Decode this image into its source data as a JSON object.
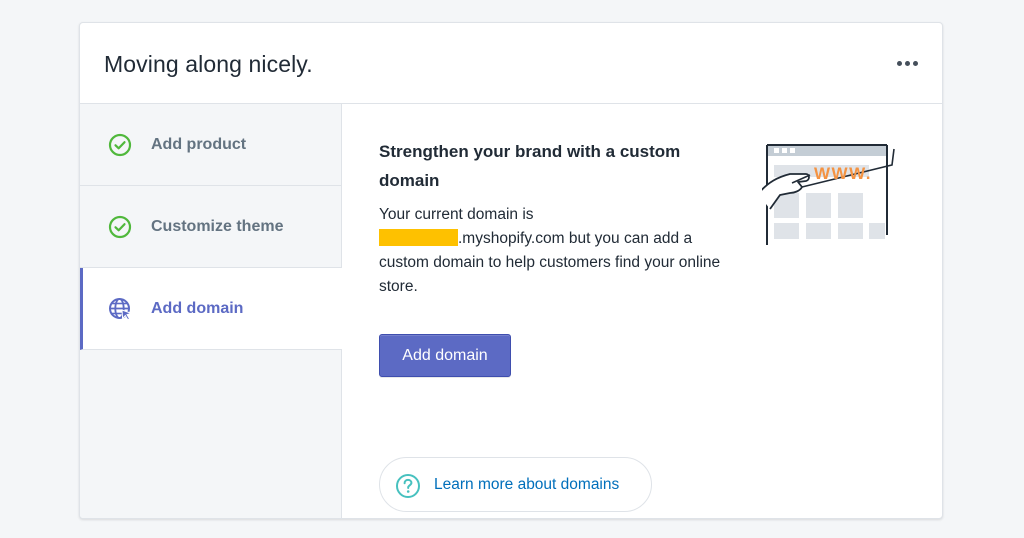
{
  "card": {
    "title": "Moving along nicely.",
    "more_icon": "horizontal-dots-icon"
  },
  "sidebar": {
    "steps": [
      {
        "label": "Add product",
        "icon": "check-circle-icon",
        "state": "completed"
      },
      {
        "label": "Customize theme",
        "icon": "check-circle-icon",
        "state": "completed"
      },
      {
        "label": "Add domain",
        "icon": "globe-cursor-icon",
        "state": "active"
      }
    ]
  },
  "content": {
    "heading": "Strengthen your brand with a custom domain",
    "body_prefix": "Your current domain is",
    "body_suffix": ".myshopify.com but you can add a custom domain to help customers find your online store.",
    "primary_button": "Add domain",
    "learn_more": "Learn more about domains",
    "illustration_text": "WWW."
  },
  "colors": {
    "accent": "#5c6ac4",
    "check_green": "#50b83c",
    "link_blue": "#006fbb",
    "help_teal": "#47c1bf",
    "redaction_yellow": "#fec100",
    "illustration_orange": "#f49342"
  }
}
